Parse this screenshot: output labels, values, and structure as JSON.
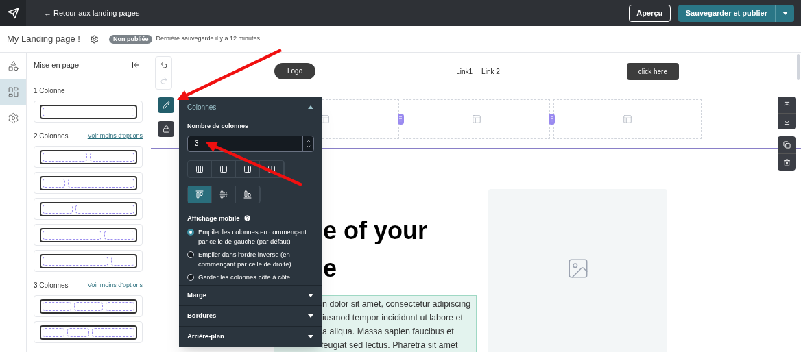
{
  "topbar": {
    "back_link": "← Retour aux landing pages",
    "preview_button": "Aperçu",
    "publish_button": "Sauvegarder et publier"
  },
  "page_header": {
    "title": "My Landing page !",
    "status_badge": "Non publiée",
    "last_saved": "Dernière sauvegarde il y a 12 minutes"
  },
  "rail": [
    {
      "selected": false
    },
    {
      "selected": true
    },
    {
      "selected": false
    }
  ],
  "sidebar": {
    "title": "Mise en page",
    "groups": [
      {
        "heading": "1 Colonne",
        "layouts": [
          {
            "kind": "single"
          }
        ]
      },
      {
        "heading": "2 Colonnes",
        "link": "Voir moins d'options",
        "layouts": [
          {
            "kind": "halves"
          },
          {
            "kind": "quarterleft"
          },
          {
            "kind": "thirdleft"
          },
          {
            "kind": "thirdright"
          },
          {
            "kind": "quarterright"
          }
        ]
      },
      {
        "heading": "3 Colonnes",
        "link": "Voir moins d'options",
        "layouts": [
          {
            "kind": "thirds"
          },
          {
            "kind": "halfright"
          }
        ]
      }
    ]
  },
  "canvas": {
    "header": {
      "logo": "Logo",
      "links": [
        "Link1",
        "Link 2"
      ],
      "cta": "click here"
    },
    "columns": [
      {
        "kind": "placeholder"
      },
      {
        "kind": "placeholder"
      },
      {
        "kind": "placeholder"
      }
    ],
    "hero": {
      "heading_lines": [
        "e of your",
        "e"
      ],
      "text_lines": [
        "n dolor sit amet, consectetur adipiscing",
        "iusmod tempor incididunt ut labore et",
        "a aliqua. Massa sapien faucibus et",
        "feugiat sed lectus. Pharetra sit amet"
      ]
    }
  },
  "panel": {
    "section_title": "Colonnes",
    "expanded": true,
    "count_label": "Nombre de colonnes",
    "count_value": "3",
    "layout_options": [
      {
        "selected": false
      },
      {
        "selected": false
      },
      {
        "selected": false
      },
      {
        "selected": false
      }
    ],
    "align_options": [
      {
        "selected": true
      },
      {
        "selected": false
      },
      {
        "selected": false
      }
    ],
    "mobile_label": "Affichage mobile",
    "mobile_options": [
      {
        "label": "Empiler les colonnes en commençant par celle de gauche (par défaut)",
        "selected": true
      },
      {
        "label": "Empiler dans l'ordre inverse (en commençant par celle de droite)",
        "selected": false
      },
      {
        "label": "Garder les colonnes côte à côte",
        "selected": false
      }
    ],
    "sections": [
      {
        "title": "Marge",
        "expanded": false
      },
      {
        "title": "Bordures",
        "expanded": false
      },
      {
        "title": "Arrière-plan",
        "expanded": false
      }
    ]
  }
}
